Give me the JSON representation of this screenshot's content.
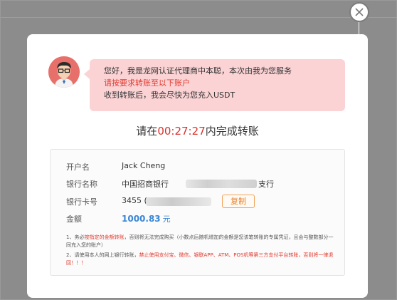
{
  "colors": {
    "overlay": "#8a8a8a",
    "bubble_bg": "#fbd3d5",
    "accent_red": "#e23a2f",
    "amount_blue": "#3a86d6",
    "copy_orange": "#e9822b"
  },
  "close": {
    "icon": "close-icon"
  },
  "agent": {
    "avatar_icon": "avatar",
    "greeting": "您好，我是龙网认证代理商中本聪，本次由我为您服务",
    "instruction": "请按要求转账至以下账户",
    "after": "收到转账后，我会尽快为您充入USDT"
  },
  "timer": {
    "prefix": "请在",
    "countdown": "00:27:27",
    "suffix": "内完成转账"
  },
  "account": {
    "holder_label": "开户名",
    "holder_value": "Jack Cheng",
    "bank_label": "银行名称",
    "bank_value_start": "中国招商银行",
    "bank_value_end": "支行",
    "card_label": "银行卡号",
    "card_value_start": "3455 (",
    "copy_label": "复制",
    "amount_label": "金额",
    "amount_value": "1000.83",
    "amount_unit": "元"
  },
  "notes": {
    "n1_a": "1、务必",
    "n1_b": "按指定的金额转账",
    "n1_c": "，否则将无法完成购买（小数点后随机增加的金额是您该笔转账的专属凭证，且会与整数部分一同充入您的账户）",
    "n2_a": "2、请使用本人的网上银行转账，",
    "n2_b": "禁止使用支付宝、微信、银联APP、ATM、POS机等第三方支付平台转账，否则将一律退回！！！"
  }
}
